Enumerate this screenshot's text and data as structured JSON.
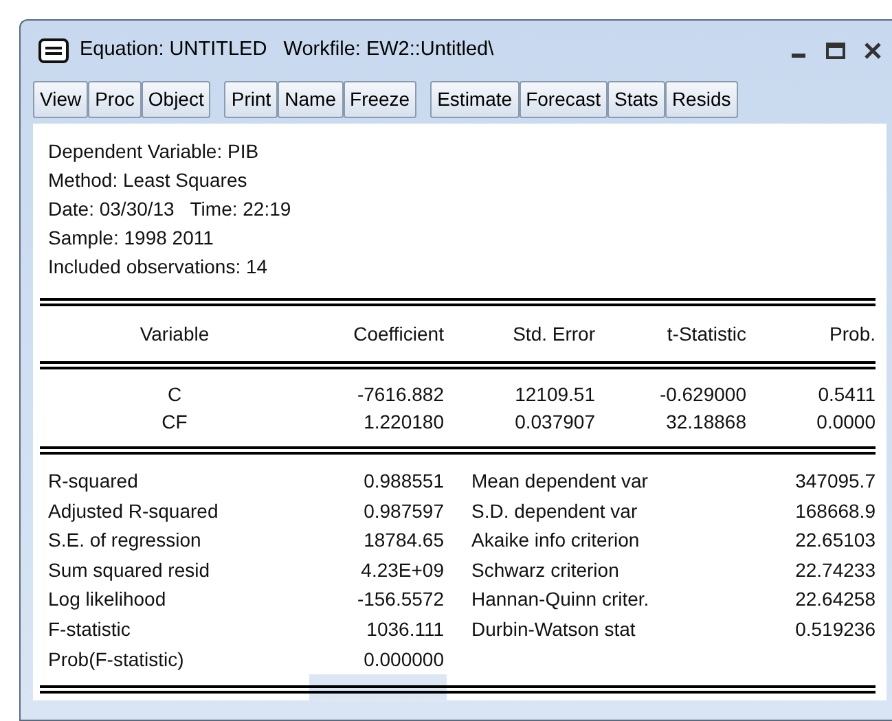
{
  "window": {
    "title": "Equation: UNTITLED   Workfile: EW2::Untitled\\"
  },
  "toolbar_groups": [
    [
      "View",
      "Proc",
      "Object"
    ],
    [
      "Print",
      "Name",
      "Freeze"
    ],
    [
      "Estimate",
      "Forecast",
      "Stats",
      "Resids"
    ]
  ],
  "header_lines": [
    "Dependent Variable: PIB",
    "Method: Least Squares",
    "Date: 03/30/13   Time: 22:19",
    "Sample: 1998 2011",
    "Included observations: 14"
  ],
  "table": {
    "columns": [
      "Variable",
      "Coefficient",
      "Std. Error",
      "t-Statistic",
      "Prob."
    ],
    "rows": [
      [
        "C",
        "-7616.882",
        "12109.51",
        "-0.629000",
        "0.5411"
      ],
      [
        "CF",
        "1.220180",
        "0.037907",
        "32.18868",
        "0.0000"
      ]
    ]
  },
  "stats": [
    {
      "label": "R-squared",
      "value": "0.988551",
      "label_2": "Mean dependent var",
      "value_2": "347095.7"
    },
    {
      "label": "Adjusted R-squared",
      "value": "0.987597",
      "label_2": "S.D. dependent var",
      "value_2": "168668.9"
    },
    {
      "label": "S.E. of regression",
      "value": "18784.65",
      "label_2": "Akaike info criterion",
      "value_2": "22.65103"
    },
    {
      "label": "Sum squared resid",
      "value": "4.23E+09",
      "label_2": "Schwarz criterion",
      "value_2": "22.74233"
    },
    {
      "label": "Log likelihood",
      "value": "-156.5572",
      "label_2": "Hannan-Quinn criter.",
      "value_2": "22.64258"
    },
    {
      "label": "F-statistic",
      "value": "1036.111",
      "label_2": "Durbin-Watson stat",
      "value_2": "0.519236"
    },
    {
      "label": "Prob(F-statistic)",
      "value": "0.000000"
    }
  ],
  "cell_cursor": true
}
